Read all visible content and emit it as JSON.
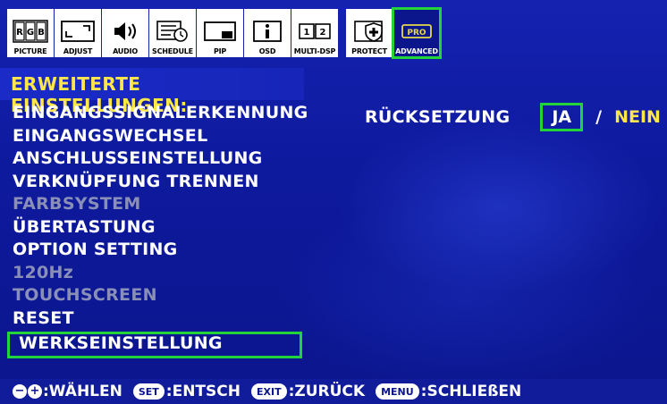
{
  "tabs": [
    {
      "id": "picture",
      "label": "PICTURE",
      "icon": "rgb-icon",
      "glyph": "RGB"
    },
    {
      "id": "adjust",
      "label": "ADJUST",
      "icon": "adjust-icon"
    },
    {
      "id": "audio",
      "label": "AUDIO",
      "icon": "speaker-icon"
    },
    {
      "id": "schedule",
      "label": "SCHEDULE",
      "icon": "schedule-icon"
    },
    {
      "id": "pip",
      "label": "PIP",
      "icon": "pip-icon"
    },
    {
      "id": "osd",
      "label": "OSD",
      "icon": "info-icon",
      "glyph": "i"
    },
    {
      "id": "multidsp",
      "label": "MULTI-DSP",
      "icon": "multi-display-icon",
      "glyph": "1 2"
    },
    {
      "id": "protect",
      "label": "PROTECT",
      "icon": "shield-icon"
    },
    {
      "id": "advanced",
      "label": "ADVANCED",
      "icon": "pro-icon",
      "glyph": "PRO",
      "selected": true
    }
  ],
  "title": "ERWEITERTE EINSTELLUNGEN:",
  "menu": [
    {
      "label": "EINGANGSSIGNALERKENNUNG",
      "enabled": true
    },
    {
      "label": "EINGANGSWECHSEL",
      "enabled": true
    },
    {
      "label": "ANSCHLUSSEINSTELLUNG",
      "enabled": true
    },
    {
      "label": "VERKNÜPFUNG TRENNEN",
      "enabled": true
    },
    {
      "label": "FARBSYSTEM",
      "enabled": false
    },
    {
      "label": "ÜBERTASTUNG",
      "enabled": true
    },
    {
      "label": "OPTION SETTING",
      "enabled": true
    },
    {
      "label": "120Hz",
      "enabled": false
    },
    {
      "label": "TOUCHSCREEN",
      "enabled": false
    },
    {
      "label": "RESET",
      "enabled": true
    },
    {
      "label": "WERKSEINSTELLUNG",
      "enabled": true,
      "selected": true
    }
  ],
  "right_pane": {
    "label": "RÜCKSETZUNG",
    "option_yes": "JA",
    "separator": "/",
    "option_no": "NEIN",
    "selected_option": "JA"
  },
  "help": {
    "select_keys": "− +",
    "select_text": ":WÄHLEN",
    "set_key": "SET",
    "set_text": ":ENTSCH",
    "exit_key": "EXIT",
    "exit_text": ":ZURÜCK",
    "menu_key": "MENU",
    "menu_text": ":SCHLIEßEN"
  },
  "colors": {
    "background": "#0b158c",
    "highlight": "#22d43a",
    "title": "#ffe64a",
    "disabled": "#8a8fb8"
  }
}
